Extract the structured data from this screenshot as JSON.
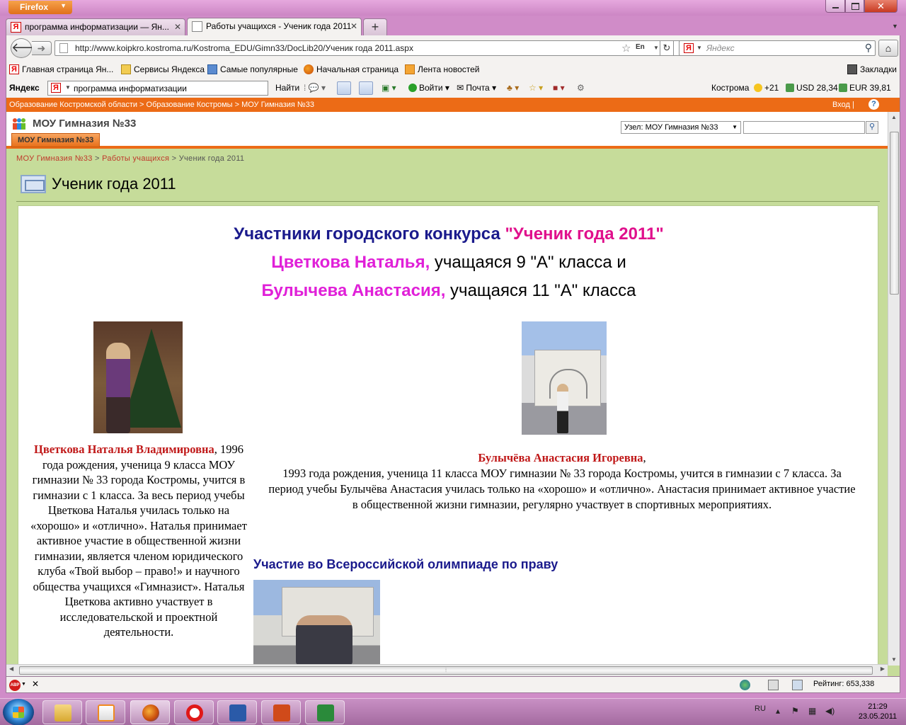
{
  "window": {
    "app_button": "Firefox",
    "close": "✕"
  },
  "tabs": [
    {
      "title": "программа информатизации — Ян...",
      "icon": "yandex-icon"
    },
    {
      "title": "Работы учащихся - Ученик года 2011",
      "icon": "page-icon"
    }
  ],
  "nav": {
    "url": "http://www.koipkro.kostroma.ru/Kostroma_EDU/Gimn33/DocLib20/Ученик года 2011.aspx",
    "lang": "En",
    "search_placeholder": "Яндекс"
  },
  "bookmarks": [
    {
      "label": "Главная страница Ян...",
      "icon": "yandex-icon"
    },
    {
      "label": "Сервисы Яндекса",
      "icon": "folder-icon"
    },
    {
      "label": "Самые популярные",
      "icon": "popular-icon"
    },
    {
      "label": "Начальная страница",
      "icon": "firefox-icon"
    },
    {
      "label": "Лента новостей",
      "icon": "rss-icon"
    }
  ],
  "bookmarks_menu": "Закладки",
  "yandex_bar": {
    "logo": "Яндекс",
    "query": "программа информатизации",
    "find": "Найти",
    "login": "Войти",
    "mail": "Почта",
    "city": "Кострома",
    "temp": "+21",
    "usd": "USD 28,34",
    "eur": "EUR 39,81"
  },
  "site": {
    "top_crumb": "Образование Костромской области > Образование Костромы > МОУ Гимназия №33",
    "login": "Вход |",
    "help": "?",
    "name": "МОУ Гимназия №33",
    "tab": "МОУ Гимназия №33",
    "scope": "Узел: МОУ Гимназия №33",
    "breadcrumb": {
      "home": "МОУ Гимназия №33",
      "sep1": " > ",
      "section": "Работы учащихся",
      "sep2": " > ",
      "current": "Ученик года 2011"
    },
    "page_title": "Ученик года 2011"
  },
  "article": {
    "heading_part1": "Участники городского конкурса ",
    "heading_part2": "\"Ученик года 2011\"",
    "line2_name": "Цветкова Наталья,",
    "line2_rest": " учащаяся 9 \"А\" класса и",
    "line3_name": "Булычева Анастасия,",
    "line3_rest": " учащаяся 11 \"А\" класса",
    "caption1_name": "Цветкова Наталья Владимировна",
    "caption1_text": ", 1996 года рождения, ученица 9 класса МОУ гимназии № 33 города Костромы, учится в гимназии с 1 класса. За весь период учебы Цветкова Наталья училась только на «хорошо» и «отлично». Наталья принимает активное участие в общественной жизни гимназии, является членом юридического клуба «Твой выбор – право!» и научного общества учащихся «Гимназист». Наталья Цветкова активно участвует в исследовательской и проектной деятельности.",
    "caption2_name": "Булычёва Анастасия Игоревна",
    "caption2_comma": ",",
    "caption2_text": "1993 года рождения, ученица 11 класса МОУ гимназии № 33 города Костромы, учится в гимназии с 7 класса. За  период учебы Булычёва Анастасия училась только на «хорошо» и «отлично». Анастасия принимает активное участие в общественной жизни гимназии, регулярно участвует в спортивных мероприятиях.",
    "olympiad_heading": "Участие во Всероссийской олимпиаде по праву"
  },
  "status": {
    "rating": "Рейтинг: 653,338"
  },
  "taskbar": {
    "lang": "RU",
    "time": "21:29",
    "date": "23.05.2011"
  }
}
